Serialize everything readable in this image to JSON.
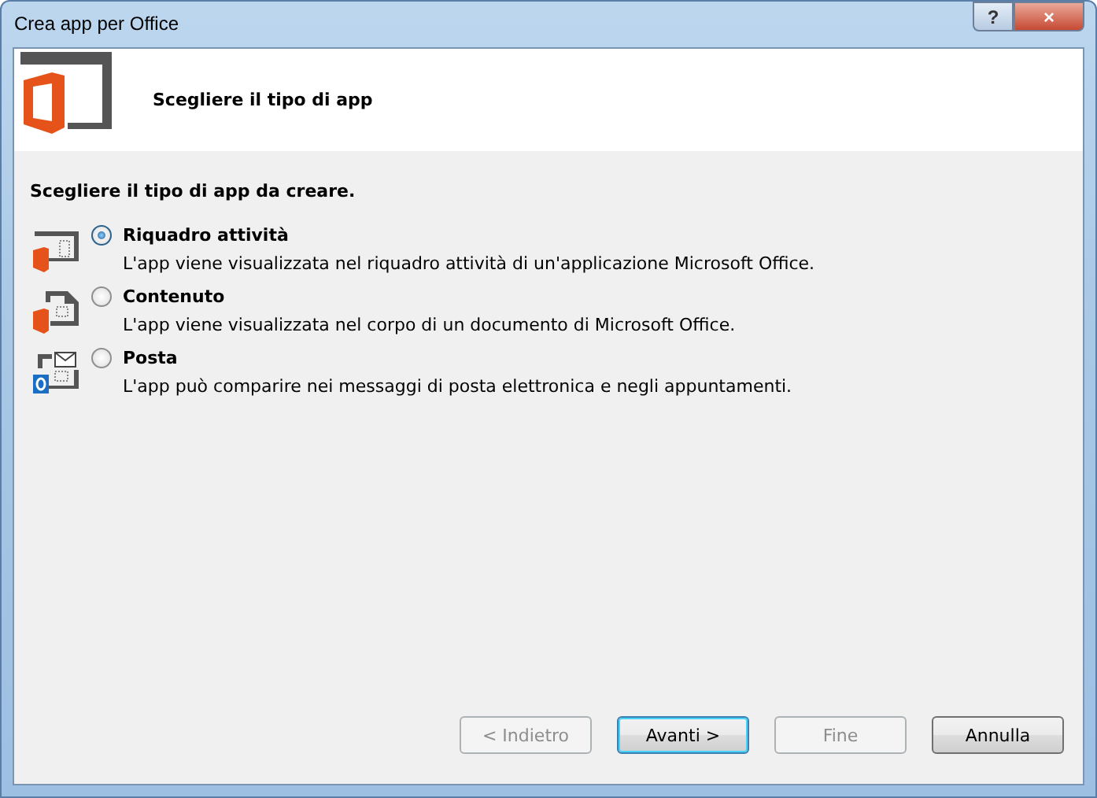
{
  "window": {
    "title": "Crea app per Office"
  },
  "title_buttons": [
    "?",
    "×"
  ],
  "header": {
    "title": "Scegliere il tipo di app"
  },
  "prompt": "Scegliere il tipo di app da creare.",
  "options": [
    {
      "kind": "taskpane",
      "label": "Riquadro attività",
      "description": "L'app viene visualizzata nel riquadro attività di un'applicazione Microsoft Office.",
      "selected": true
    },
    {
      "kind": "content",
      "label": "Contenuto",
      "description": "L'app viene visualizzata nel corpo di un documento di Microsoft Office.",
      "selected": false
    },
    {
      "kind": "mail",
      "label": "Posta",
      "description": "L'app può comparire nei messaggi di posta elettronica e negli appuntamenti.",
      "selected": false
    }
  ],
  "buttons": [
    {
      "label": "< Indietro",
      "disabled": true,
      "default": false
    },
    {
      "label": "Avanti >",
      "disabled": false,
      "default": true
    },
    {
      "label": "Fine",
      "disabled": true,
      "default": false
    },
    {
      "label": "Annulla",
      "disabled": false,
      "default": false
    }
  ]
}
